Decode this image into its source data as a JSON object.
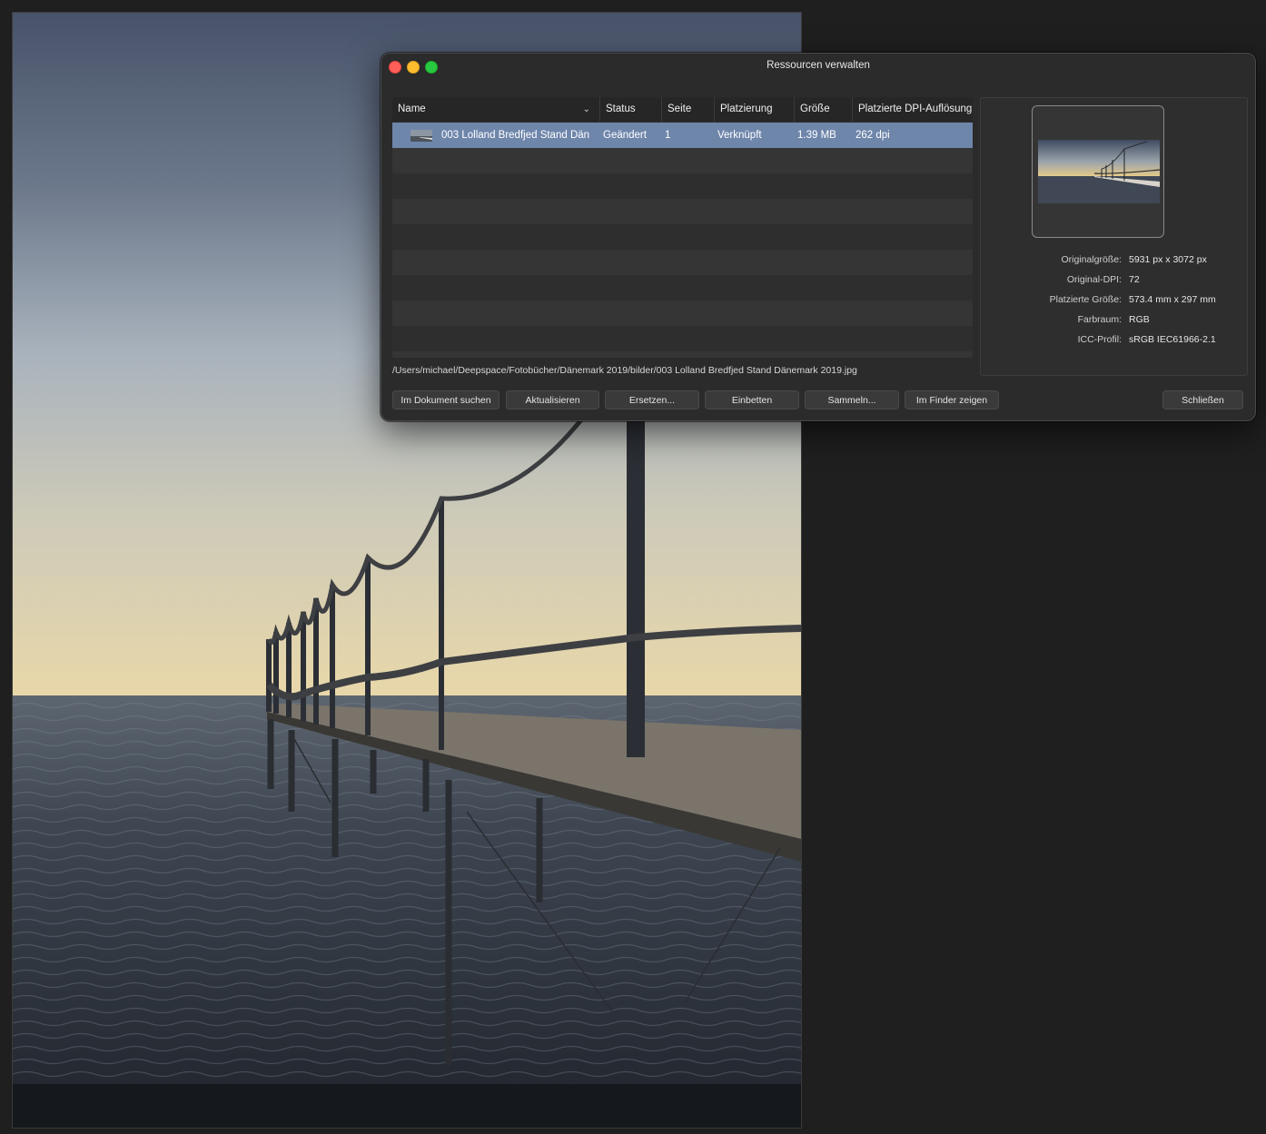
{
  "dialog": {
    "title": "Ressourcen verwalten"
  },
  "table": {
    "columns": [
      {
        "label": "Name"
      },
      {
        "label": "Status"
      },
      {
        "label": "Seite"
      },
      {
        "label": "Platzierung"
      },
      {
        "label": "Größe"
      },
      {
        "label": "Platzierte DPI-Auflösung"
      }
    ],
    "rows": [
      {
        "name": "003 Lolland Bredfjed Stand Dän",
        "status": "Geändert",
        "page": "1",
        "placement": "Verknüpft",
        "size": "1.39 MB",
        "dpi": "262 dpi"
      }
    ]
  },
  "file_path": "/Users/michael/Deepspace/Fotobücher/Dänemark 2019/bilder/003 Lolland Bredfjed Stand Dänemark 2019.jpg",
  "info": [
    {
      "label": "Originalgröße:",
      "value": "5931 px x 3072 px"
    },
    {
      "label": "Original-DPI:",
      "value": "72"
    },
    {
      "label": "Platzierte Größe:",
      "value": "573.4 mm x 297 mm"
    },
    {
      "label": "Farbraum:",
      "value": "RGB"
    },
    {
      "label": "ICC-Profil:",
      "value": "sRGB IEC61966-2.1"
    }
  ],
  "buttons": {
    "find_in_document": "Im Dokument suchen",
    "update": "Aktualisieren",
    "replace": "Ersetzen...",
    "embed": "Einbetten",
    "collect": "Sammeln...",
    "show_in_finder": "Im Finder zeigen",
    "close": "Schließen"
  }
}
